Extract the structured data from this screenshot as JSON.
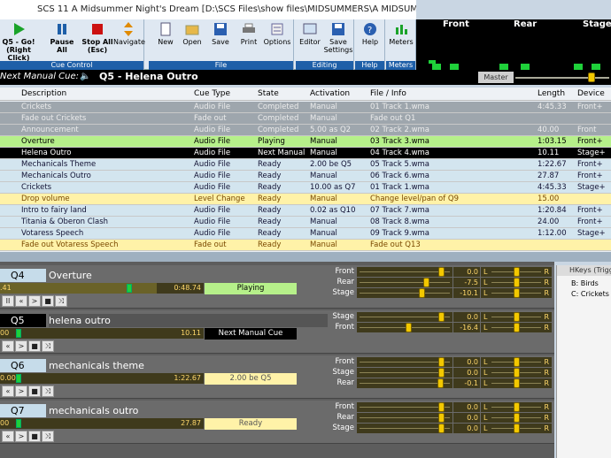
{
  "window": {
    "title": "SCS 11  A Midsummer Night's Dream [D:\\SCS Files\\show files\\MIDSUMMERS\\A MIDSUMMER NIGHTS DREAM.scs11]"
  },
  "ribbon": {
    "cue_control": {
      "label": "Cue Control",
      "go": "Q5 - Go! (Right Click)",
      "pause": "Pause All",
      "stop": "Stop All (Esc)",
      "navigate": "Navigate"
    },
    "file": {
      "label": "File",
      "new": "New",
      "open": "Open",
      "save": "Save",
      "print": "Print",
      "options": "Options"
    },
    "editing": {
      "label": "Editing",
      "editor": "Editor",
      "save_settings": "Save Settings"
    },
    "help": {
      "label": "Help",
      "help": "Help"
    },
    "meters": {
      "label": "Meters",
      "meters": "Meters"
    }
  },
  "vu": {
    "channels": [
      "Front",
      "Rear",
      "Stage"
    ]
  },
  "next_cue": {
    "label": "Next Manual Cue:",
    "cue": "Q5 - Helena Outro"
  },
  "master": {
    "label": "Master"
  },
  "grid": {
    "headers": {
      "desc": "Description",
      "type": "Cue Type",
      "state": "State",
      "act": "Activation",
      "file": "File / Info",
      "len": "Length",
      "dev": "Device"
    },
    "rows": [
      {
        "desc": "Crickets",
        "type": "Audio File",
        "state": "Completed",
        "act": "Manual",
        "file": "01 Track 1.wma",
        "len": "4:45.33",
        "dev": "Front+"
      },
      {
        "desc": "Fade out Crickets",
        "type": "Fade out",
        "state": "Completed",
        "act": "Manual",
        "file": "Fade out Q1",
        "len": "",
        "dev": ""
      },
      {
        "desc": "Announcement",
        "type": "Audio File",
        "state": "Completed",
        "act": "5.00 as Q2",
        "file": "02 Track 2.wma",
        "len": "40.00",
        "dev": "Front"
      },
      {
        "desc": "Overture",
        "type": "Audio File",
        "state": "Playing",
        "act": "Manual",
        "file": "03 Track 3.wma",
        "len": "1:03.15",
        "dev": "Front+"
      },
      {
        "desc": "Helena Outro",
        "type": "Audio File",
        "state": "Next Manual",
        "act": "Manual",
        "file": "04 Track 4.wma",
        "len": "10.11",
        "dev": "Stage+"
      },
      {
        "desc": "Mechanicals Theme",
        "type": "Audio File",
        "state": "Ready",
        "act": "2.00 be Q5",
        "file": "05 Track 5.wma",
        "len": "1:22.67",
        "dev": "Front+"
      },
      {
        "desc": "Mechanicals Outro",
        "type": "Audio File",
        "state": "Ready",
        "act": "Manual",
        "file": "06 Track 6.wma",
        "len": "27.87",
        "dev": "Front+"
      },
      {
        "desc": "Crickets",
        "type": "Audio File",
        "state": "Ready",
        "act": "10.00 as Q7",
        "file": "01 Track 1.wma",
        "len": "4:45.33",
        "dev": "Stage+"
      },
      {
        "desc": "Drop volume",
        "type": "Level Change",
        "state": "Ready",
        "act": "Manual",
        "file": "Change level/pan of Q9",
        "len": "15.00",
        "dev": ""
      },
      {
        "desc": "Intro to fairy land",
        "type": "Audio File",
        "state": "Ready",
        "act": "0.02 as Q10",
        "file": "07 Track 7.wma",
        "len": "1:20.84",
        "dev": "Front+"
      },
      {
        "desc": "Titania & Oberon Clash",
        "type": "Audio File",
        "state": "Ready",
        "act": "Manual",
        "file": "08 Track 8.wma",
        "len": "24.00",
        "dev": "Front+"
      },
      {
        "desc": "Votaress Speech",
        "type": "Audio File",
        "state": "Ready",
        "act": "Manual",
        "file": "09 Track 9.wma",
        "len": "1:12.00",
        "dev": "Stage+"
      },
      {
        "desc": "Fade out Votaress Speech",
        "type": "Fade out",
        "state": "Ready",
        "act": "Manual",
        "file": "Fade out Q13",
        "len": "",
        "dev": ""
      }
    ]
  },
  "cue_panels": [
    {
      "num": "Q4",
      "desc": "Overture",
      "t_start": ".41",
      "t_end": "0:48.74",
      "progress": 0.77,
      "state": "Playing",
      "devices": [
        {
          "name": "Front",
          "db": "0.0",
          "level": 0.92
        },
        {
          "name": "Rear",
          "db": "-7.5",
          "level": 0.75
        },
        {
          "name": "Stage",
          "db": "-10.1",
          "level": 0.7
        }
      ]
    },
    {
      "num": "Q5",
      "desc": "helena outro",
      "t_start": "00",
      "t_end": "10.11",
      "progress": 0.0,
      "state": "Next Manual Cue",
      "devices": [
        {
          "name": "Stage",
          "db": "0.0",
          "level": 0.92
        },
        {
          "name": "Front",
          "db": "-16.4",
          "level": 0.55
        }
      ]
    },
    {
      "num": "Q6",
      "desc": "mechanicals theme",
      "t_start": "0.00",
      "t_end": "1:22.67",
      "progress": 0.0,
      "state": "2.00 be Q5",
      "devices": [
        {
          "name": "Front",
          "db": "0.0",
          "level": 0.92
        },
        {
          "name": "Stage",
          "db": "0.0",
          "level": 0.92
        },
        {
          "name": "Rear",
          "db": "-0.1",
          "level": 0.91
        }
      ]
    },
    {
      "num": "Q7",
      "desc": "mechanicals outro",
      "t_start": "00",
      "t_end": "27.87",
      "progress": 0.0,
      "state": "Ready",
      "devices": [
        {
          "name": "Front",
          "db": "0.0",
          "level": 0.92
        },
        {
          "name": "Rear",
          "db": "0.0",
          "level": 0.92
        },
        {
          "name": "Stage",
          "db": "0.0",
          "level": 0.92
        }
      ]
    }
  ],
  "transport": {
    "pause": "II",
    "rewind": "«",
    "play": ">",
    "stop": "■",
    "shuffle": "⤨"
  },
  "pan": {
    "left": "L",
    "right": "R"
  },
  "hotkeys": {
    "header": "HKeys (Trigg",
    "items": [
      "B: Birds",
      "C: Crickets"
    ]
  },
  "colors": {
    "completed": "#9aa3aa",
    "playing": "#b6f08a",
    "next": "#000000",
    "ready_bg": "#d2e4ee",
    "level_change": "#fff2a8"
  }
}
